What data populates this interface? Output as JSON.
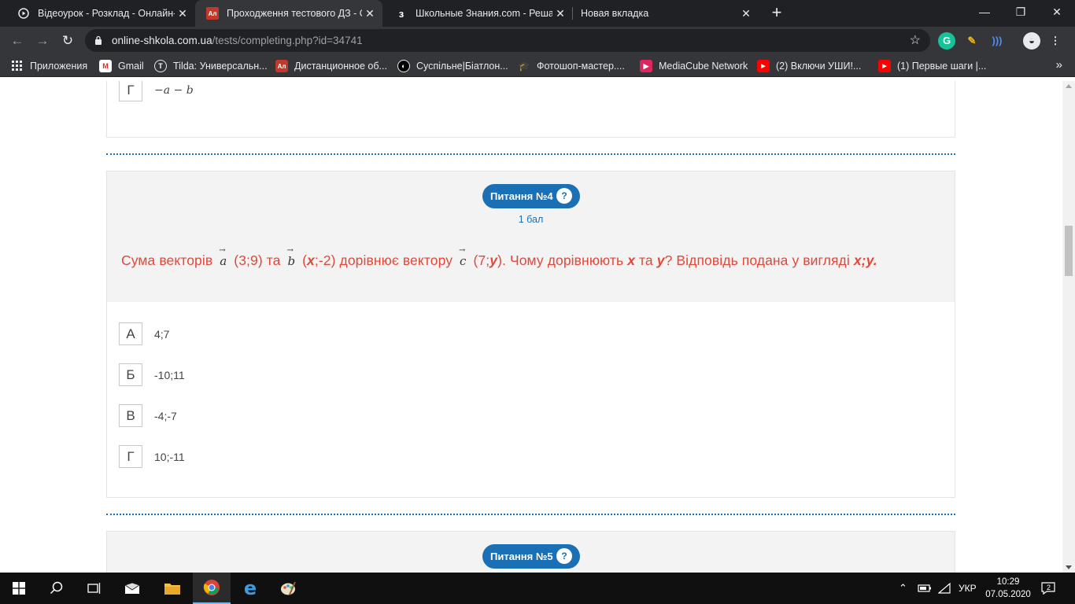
{
  "browser": {
    "tabs": [
      {
        "title": "Відеоурок - Розклад - Онлайн-Ш",
        "favicon": "video-icon",
        "active": false
      },
      {
        "title": "Проходження тестового ДЗ - Ол",
        "favicon": "test-site-icon",
        "active": true
      },
      {
        "title": "Школьные Знания.com - Решае",
        "favicon": "znania-icon",
        "active": false
      },
      {
        "title": "Новая вкладка",
        "favicon": "",
        "active": false
      }
    ],
    "url_host": "online-shkola.com.ua",
    "url_path": "/tests/completing.php?id=34741",
    "bookmarks": [
      {
        "label": "Приложения",
        "icon": "apps-grid-icon"
      },
      {
        "label": "Gmail",
        "icon": "gmail-icon"
      },
      {
        "label": "Tilda: Универсальн...",
        "icon": "tilda-icon"
      },
      {
        "label": "Дистанционное об...",
        "icon": "test-site-icon"
      },
      {
        "label": "Суспільне|Біатлон...",
        "icon": "suspilne-icon"
      },
      {
        "label": "Фотошоп-мастер....",
        "icon": "graduation-cap-icon"
      },
      {
        "label": "MediaCube Network",
        "icon": "mediacube-icon"
      },
      {
        "label": "(2) Включи УШИ!...",
        "icon": "youtube-icon"
      },
      {
        "label": "(1) Первые шаги |...",
        "icon": "youtube-icon"
      }
    ]
  },
  "prev_question": {
    "last_answer": {
      "letter": "Г",
      "text": "−a − b"
    }
  },
  "question4": {
    "badge": "Питання №4",
    "help": "?",
    "points": "1 бал",
    "text": {
      "p1": "Сума векторів",
      "vec_a": "a",
      "p2": "(3;9) та",
      "vec_b": "b",
      "p3": "(",
      "x1": "x",
      "p4": ";-2) дорівнює вектору",
      "vec_c": "c",
      "p5": "(7;",
      "y1": "y",
      "p6": "). Чому дорівнюють",
      "x2": "x",
      "p7": "та",
      "y2": "y",
      "p8": "? Відповідь подана у вигляді",
      "fmt": "x;y."
    },
    "answers": [
      {
        "letter": "А",
        "text": "4;7"
      },
      {
        "letter": "Б",
        "text": "-10;11"
      },
      {
        "letter": "В",
        "text": "-4;-7"
      },
      {
        "letter": "Г",
        "text": "10;-11"
      }
    ]
  },
  "question5": {
    "badge": "Питання №5",
    "help": "?"
  },
  "taskbar": {
    "language": "УКР",
    "time": "10:29",
    "date": "07.05.2020",
    "notifications": "2"
  },
  "colors": {
    "accent": "#1a6fb5",
    "question_text": "#e0483a"
  }
}
